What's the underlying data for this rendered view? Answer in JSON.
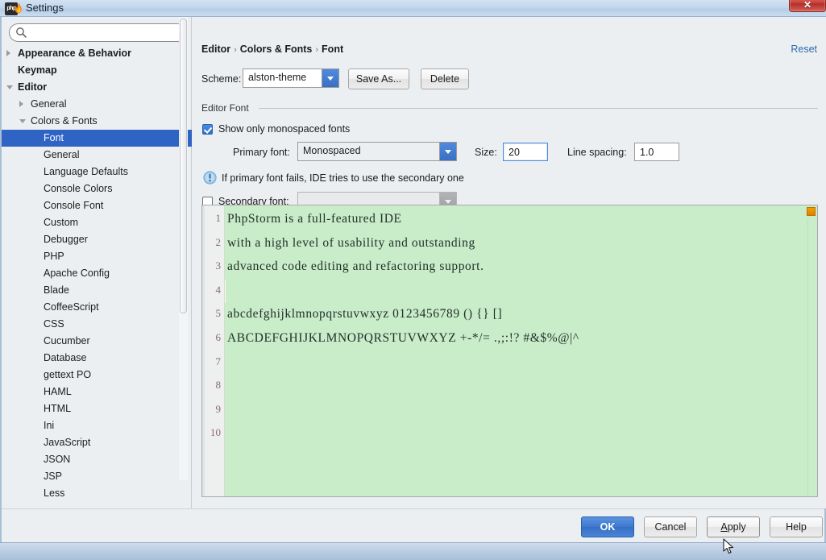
{
  "window": {
    "title": "Settings",
    "app_icon": "phpstorm-icon",
    "close_label": "✕"
  },
  "sidebar": {
    "search": {
      "value": "",
      "placeholder": "",
      "icon": "search-icon"
    },
    "items": [
      {
        "label": "Appearance & Behavior",
        "depth": 0,
        "bold": true,
        "arrow": "collapsed",
        "selected": false
      },
      {
        "label": "Keymap",
        "depth": 0,
        "bold": true,
        "arrow": "none",
        "selected": false
      },
      {
        "label": "Editor",
        "depth": 0,
        "bold": true,
        "arrow": "expanded",
        "selected": false
      },
      {
        "label": "General",
        "depth": 1,
        "bold": false,
        "arrow": "collapsed",
        "selected": false
      },
      {
        "label": "Colors & Fonts",
        "depth": 1,
        "bold": false,
        "arrow": "expanded",
        "selected": false
      },
      {
        "label": "Font",
        "depth": 2,
        "bold": false,
        "arrow": "none",
        "selected": true
      },
      {
        "label": "General",
        "depth": 2,
        "bold": false,
        "arrow": "none",
        "selected": false
      },
      {
        "label": "Language Defaults",
        "depth": 2,
        "bold": false,
        "arrow": "none",
        "selected": false
      },
      {
        "label": "Console Colors",
        "depth": 2,
        "bold": false,
        "arrow": "none",
        "selected": false
      },
      {
        "label": "Console Font",
        "depth": 2,
        "bold": false,
        "arrow": "none",
        "selected": false
      },
      {
        "label": "Custom",
        "depth": 2,
        "bold": false,
        "arrow": "none",
        "selected": false
      },
      {
        "label": "Debugger",
        "depth": 2,
        "bold": false,
        "arrow": "none",
        "selected": false
      },
      {
        "label": "PHP",
        "depth": 2,
        "bold": false,
        "arrow": "none",
        "selected": false
      },
      {
        "label": "Apache Config",
        "depth": 2,
        "bold": false,
        "arrow": "none",
        "selected": false
      },
      {
        "label": "Blade",
        "depth": 2,
        "bold": false,
        "arrow": "none",
        "selected": false
      },
      {
        "label": "CoffeeScript",
        "depth": 2,
        "bold": false,
        "arrow": "none",
        "selected": false
      },
      {
        "label": "CSS",
        "depth": 2,
        "bold": false,
        "arrow": "none",
        "selected": false
      },
      {
        "label": "Cucumber",
        "depth": 2,
        "bold": false,
        "arrow": "none",
        "selected": false
      },
      {
        "label": "Database",
        "depth": 2,
        "bold": false,
        "arrow": "none",
        "selected": false
      },
      {
        "label": "gettext PO",
        "depth": 2,
        "bold": false,
        "arrow": "none",
        "selected": false
      },
      {
        "label": "HAML",
        "depth": 2,
        "bold": false,
        "arrow": "none",
        "selected": false
      },
      {
        "label": "HTML",
        "depth": 2,
        "bold": false,
        "arrow": "none",
        "selected": false
      },
      {
        "label": "Ini",
        "depth": 2,
        "bold": false,
        "arrow": "none",
        "selected": false
      },
      {
        "label": "JavaScript",
        "depth": 2,
        "bold": false,
        "arrow": "none",
        "selected": false
      },
      {
        "label": "JSON",
        "depth": 2,
        "bold": false,
        "arrow": "none",
        "selected": false
      },
      {
        "label": "JSP",
        "depth": 2,
        "bold": false,
        "arrow": "none",
        "selected": false
      },
      {
        "label": "Less",
        "depth": 2,
        "bold": false,
        "arrow": "none",
        "selected": false
      }
    ]
  },
  "breadcrumb": {
    "part1": "Editor",
    "sep": "›",
    "part2": "Colors & Fonts",
    "part3": "Font"
  },
  "reset_link": "Reset",
  "scheme": {
    "label": "Scheme:",
    "value": "alston-theme",
    "save_as_label": "Save As...",
    "delete_label": "Delete"
  },
  "editor_font": {
    "group_title": "Editor Font",
    "show_monospaced_label": "Show only monospaced fonts",
    "show_monospaced_checked": true,
    "primary_font_label": "Primary font:",
    "primary_font_value": "Monospaced",
    "size_label": "Size:",
    "size_value": "20",
    "line_spacing_label": "Line spacing:",
    "line_spacing_value": "1.0",
    "info_text": "If primary font fails, IDE tries to use the secondary one",
    "info_icon": "info-icon",
    "secondary_font_label": "Secondary font:",
    "secondary_font_value": "",
    "secondary_font_checked": false
  },
  "preview": {
    "line_numbers": [
      "1",
      "2",
      "3",
      "4",
      "5",
      "6",
      "7",
      "8",
      "9",
      "10"
    ],
    "lines": [
      "PhpStorm is a full-featured IDE",
      "with a high level of usability and outstanding",
      "advanced code editing and refactoring support.",
      "",
      "abcdefghijklmnopqrstuvwxyz 0123456789 () {} []",
      "ABCDEFGHIJKLMNOPQRSTUVWXYZ +-*/= .,;:!? #&$%@|^"
    ],
    "caret_line": 4,
    "bg_color": "#c9ecc9",
    "caret_line_color": "#fdfbe4",
    "gutter_color": "#eef0ef",
    "line_number_color": "#8a6a6a",
    "marker_color": "#e89000"
  },
  "buttons": {
    "ok": "OK",
    "cancel": "Cancel",
    "apply_mnemonic": "A",
    "apply_rest": "pply",
    "help": "Help"
  }
}
